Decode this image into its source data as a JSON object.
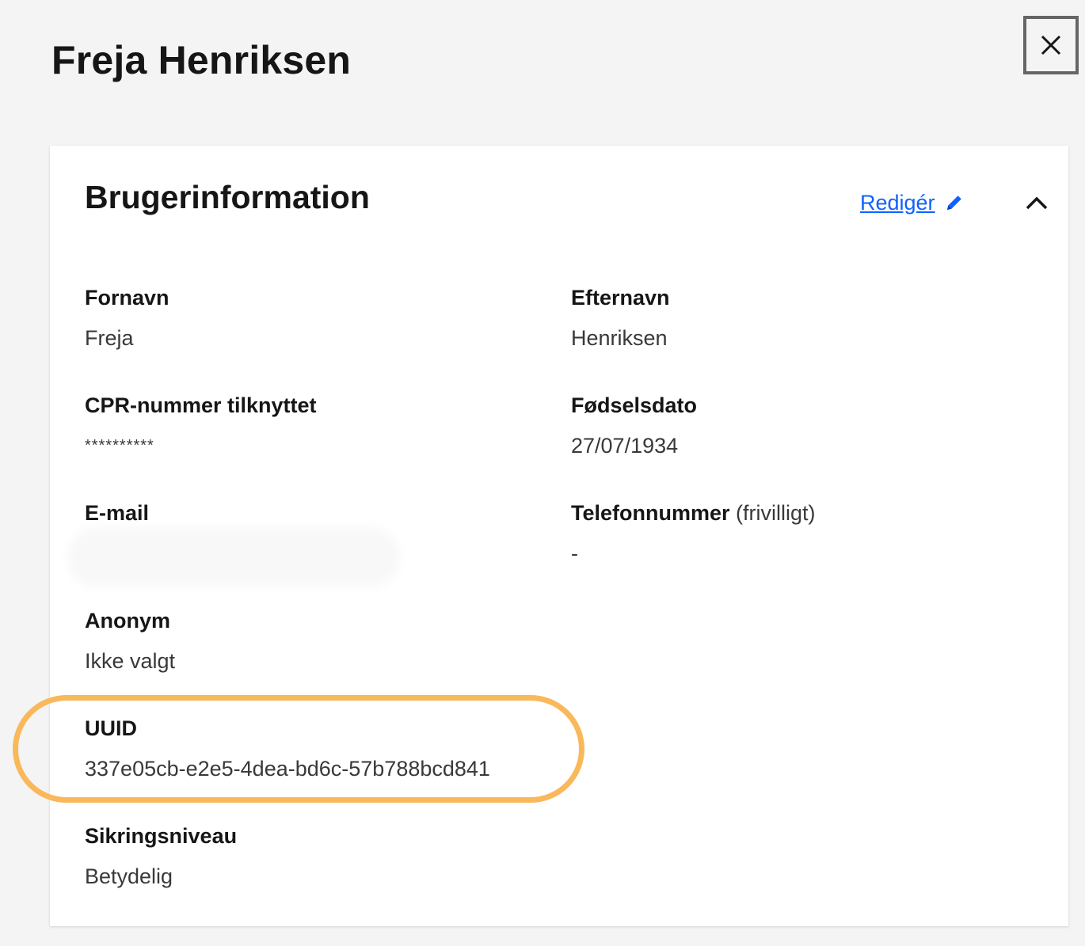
{
  "header": {
    "title": "Freja Henriksen",
    "close_icon": "close-icon"
  },
  "card": {
    "title": "Brugerinformation",
    "edit_label": "Redigér",
    "edit_icon": "pencil-icon",
    "collapse_icon": "chevron-up-icon",
    "link_color": "#0f62fe"
  },
  "fields": {
    "first_name": {
      "label": "Fornavn",
      "value": "Freja"
    },
    "last_name": {
      "label": "Efternavn",
      "value": "Henriksen"
    },
    "cpr": {
      "label": "CPR-nummer tilknyttet",
      "value": "**********"
    },
    "birth_date": {
      "label": "Fødselsdato",
      "value": "27/07/1934"
    },
    "email": {
      "label": "E-mail",
      "value": ""
    },
    "phone": {
      "label": "Telefonnummer",
      "label_suffix": "(frivilligt)",
      "value": "-"
    },
    "anonymous": {
      "label": "Anonym",
      "value": "Ikke valgt"
    },
    "uuid": {
      "label": "UUID",
      "value": "337e05cb-e2e5-4dea-bd6c-57b788bcd841"
    },
    "assurance_level": {
      "label": "Sikringsniveau",
      "value": "Betydelig"
    }
  },
  "highlight": {
    "color": "#f9b85a"
  }
}
